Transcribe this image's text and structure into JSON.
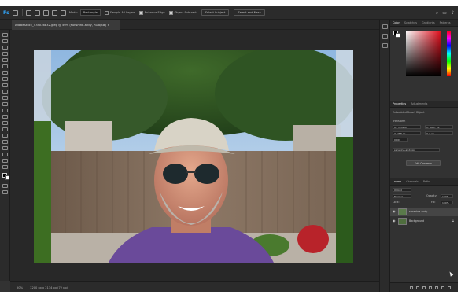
{
  "options_bar": {
    "app_logo": "Ps",
    "mode_label": "Mode:",
    "mode_value": "Rectangle",
    "sample_all_layers": "Sample All Layers",
    "enhance_edge": "Enhance Edge",
    "object_subtract": "Object Subtract",
    "select_subject": "Select Subject",
    "select_and_mask": "Select and Mask"
  },
  "document_tab": {
    "title": "AdobeStock_578036832.jpeg @ 50% (sunshine-andy, RGB/8#) ×"
  },
  "status_bar": {
    "zoom": "50%",
    "doc_info": "3200 px x 2134 px (72 ppi)"
  },
  "color_panel": {
    "tabs": [
      "Color",
      "Swatches",
      "Gradients",
      "Patterns"
    ],
    "active": "Color"
  },
  "properties_panel": {
    "tabs": [
      "Properties",
      "Adjustments"
    ],
    "active": "Properties",
    "object_type": "Embedded Smart Object",
    "transform_label": "Transform",
    "w": "W: 3952 px",
    "h": "H: 2657 px",
    "x": "X: 288 px",
    "y": "Y: 0 px",
    "angle": "0.00°",
    "filename": "sunshine-andy.jpg",
    "button_label": "Edit Contents"
  },
  "layers_panel": {
    "tabs": [
      "Layers",
      "Channels",
      "Paths"
    ],
    "active": "Layers",
    "kind_label": "Q Kind",
    "blend_mode": "Normal",
    "opacity_label": "Opacity:",
    "opacity_value": "100%",
    "lock_label": "Lock:",
    "fill_label": "Fill:",
    "fill_value": "100%",
    "layers": [
      {
        "name": "sunshine-andy",
        "selected": true
      },
      {
        "name": "Background",
        "selected": false
      }
    ]
  },
  "colors": {
    "app_bg": "#323232",
    "canvas_bg": "#282828",
    "accent": "#31a8ff",
    "fg_swatch": "#000000",
    "bg_swatch": "#ffffff",
    "picker_red": "#e3101e"
  }
}
